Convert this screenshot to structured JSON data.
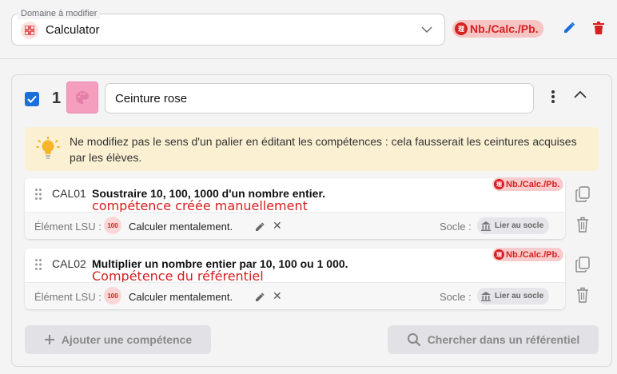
{
  "domain": {
    "legend": "Domaine à modifier",
    "value": "Calculator",
    "icon": "calculator-grid-icon",
    "badge": "Nb./Calc./Pb."
  },
  "level": {
    "number": "1",
    "checked": true,
    "color": "#f59fbf",
    "name": "Ceinture rose"
  },
  "warning": {
    "text": "Ne modifiez pas le sens d'un palier en éditant les compétences : cela fausserait les ceintures acquises par les élèves."
  },
  "competences": [
    {
      "code": "CAL01",
      "title": "Soustraire 10, 100, 1000 d'un nombre entier.",
      "note": "compétence créée manuellement",
      "badge": "Nb./Calc./Pb.",
      "lsu_label": "Élément LSU :",
      "lsu_value": "Calculer mentalement.",
      "socle_label": "Socle :",
      "socle_button": "Lier au socle"
    },
    {
      "code": "CAL02",
      "title": "Multiplier un nombre entier par 10, 100 ou 1 000.",
      "note": "Compétence du référentiel",
      "badge": "Nb./Calc./Pb.",
      "lsu_label": "Élément LSU :",
      "lsu_value": "Calculer mentalement.",
      "socle_label": "Socle :",
      "socle_button": "Lier au socle"
    }
  ],
  "actions": {
    "add": "Ajouter une compétence",
    "search": "Chercher dans un référentiel"
  },
  "colors": {
    "accent": "#1b6fd9",
    "danger": "#d62020",
    "warning_bg": "#fbf0d2"
  }
}
